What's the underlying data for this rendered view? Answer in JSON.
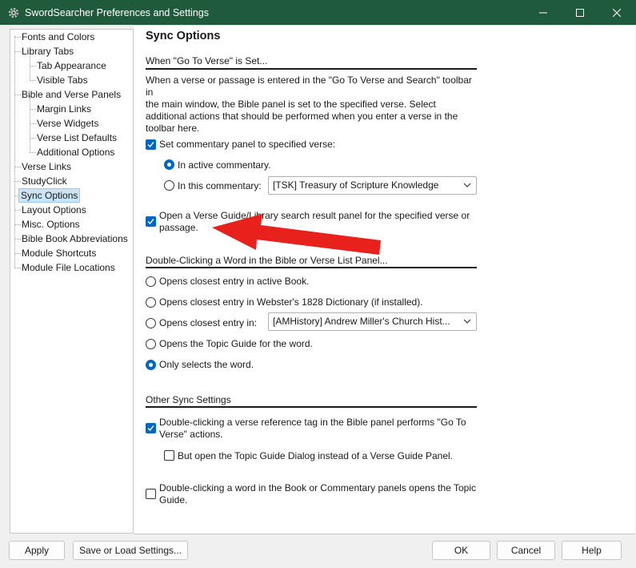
{
  "window": {
    "title": "SwordSearcher Preferences and Settings",
    "minimize": "—",
    "maximize": "☐",
    "close": "✕"
  },
  "tree": {
    "items": [
      {
        "label": "Fonts and Colors"
      },
      {
        "label": "Library Tabs"
      },
      {
        "label": "Tab Appearance"
      },
      {
        "label": "Visible Tabs"
      },
      {
        "label": "Bible and Verse Panels"
      },
      {
        "label": "Margin Links"
      },
      {
        "label": "Verse Widgets"
      },
      {
        "label": "Verse List Defaults"
      },
      {
        "label": "Additional Options"
      },
      {
        "label": "Verse Links"
      },
      {
        "label": "StudyClick"
      },
      {
        "label": "Sync Options"
      },
      {
        "label": "Layout Options"
      },
      {
        "label": "Misc. Options"
      },
      {
        "label": "Bible Book Abbreviations"
      },
      {
        "label": "Module Shortcuts"
      },
      {
        "label": "Module File Locations"
      }
    ],
    "selected": "Sync Options"
  },
  "content": {
    "title": "Sync Options",
    "goto": {
      "heading": "When \"Go To Verse\" is Set...",
      "description_lines": [
        "When a verse or passage is entered in the \"Go To Verse and Search\" toolbar in",
        "the main window, the Bible panel is set to the specified verse. Select",
        "additional actions that should be performed when you enter a verse in the",
        "toolbar here."
      ],
      "set_commentary_label": "Set commentary panel to specified verse:",
      "set_commentary_checked": true,
      "in_active_label": "In active commentary.",
      "in_active_checked": true,
      "in_this_label": "In this commentary:",
      "in_this_checked": false,
      "commentary_select": "[TSK] Treasury of Scripture Knowledge",
      "open_guide_line1": "Open a Verse Guide/Library search result panel for the specified verse or",
      "open_guide_line2": "passage.",
      "open_guide_checked": true
    },
    "dblclick": {
      "heading": "Double-Clicking a Word in the Bible or Verse List Panel...",
      "opt_active_book": "Opens closest entry in active Book.",
      "opt_websters": "Opens closest entry in Webster's 1828 Dictionary (if installed).",
      "opt_entry_in": "Opens closest entry in:",
      "entry_select": "[AMHistory] Andrew Miller's Church Hist...",
      "opt_topic_guide": "Opens the Topic Guide for the word.",
      "opt_only_select": "Only selects the word.",
      "selected_option": "Only selects the word."
    },
    "other": {
      "heading": "Other Sync Settings",
      "verse_ref_line1": "Double-clicking a verse reference tag in the Bible panel performs \"Go To",
      "verse_ref_line2": "Verse\" actions.",
      "verse_ref_checked": true,
      "topic_dialog_label": "But open the Topic Guide Dialog instead of a Verse Guide Panel.",
      "topic_dialog_checked": false,
      "word_book_line1": "Double-clicking a word in the Book or Commentary panels opens the Topic",
      "word_book_line2": "Guide.",
      "word_book_checked": false
    }
  },
  "buttons": {
    "apply": "Apply",
    "save_load": "Save or Load Settings...",
    "ok": "OK",
    "cancel": "Cancel",
    "help": "Help"
  },
  "colors": {
    "titlebar": "#1f5a3c",
    "accent": "#0067c0",
    "annotation_arrow": "#e8211c"
  }
}
